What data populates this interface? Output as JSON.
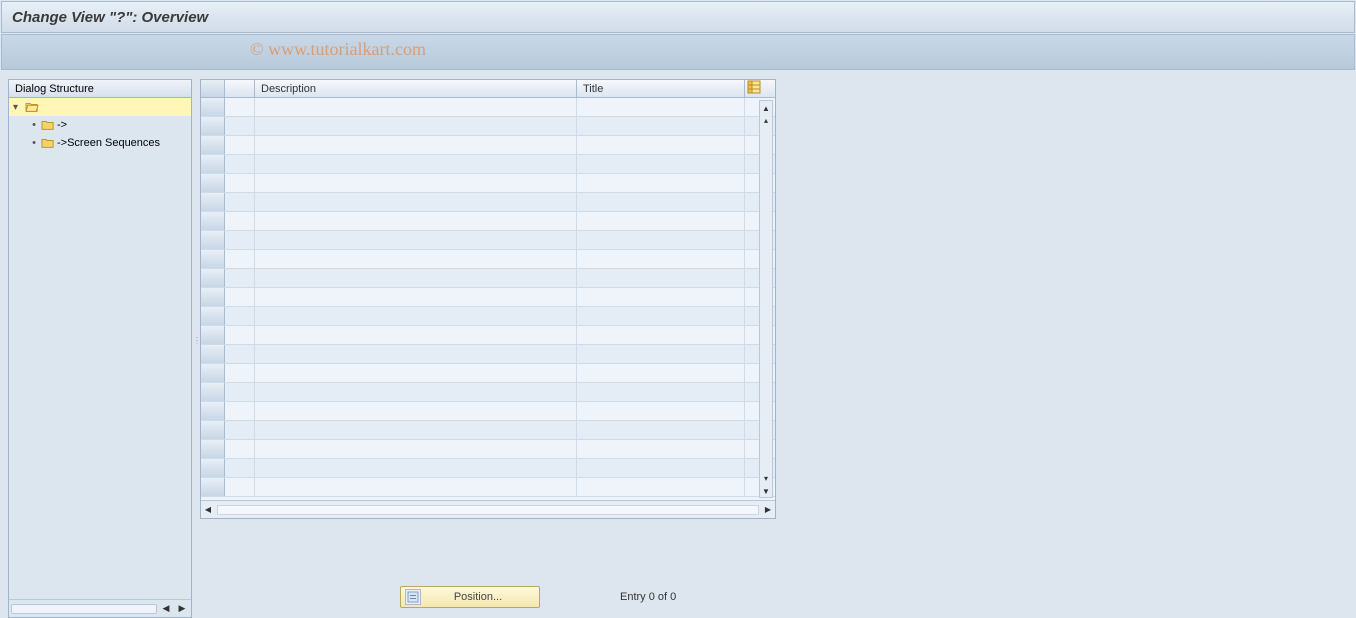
{
  "header": {
    "title": "Change View \"?\": Overview"
  },
  "watermark": "© www.tutorialkart.com",
  "tree": {
    "header": "Dialog Structure",
    "root_label": "",
    "child1_label": "->",
    "child2_label": "->Screen Sequences"
  },
  "table": {
    "col_description": "Description",
    "col_title": "Title"
  },
  "footer": {
    "position_label": "Position...",
    "entry_label": "Entry 0 of 0"
  }
}
